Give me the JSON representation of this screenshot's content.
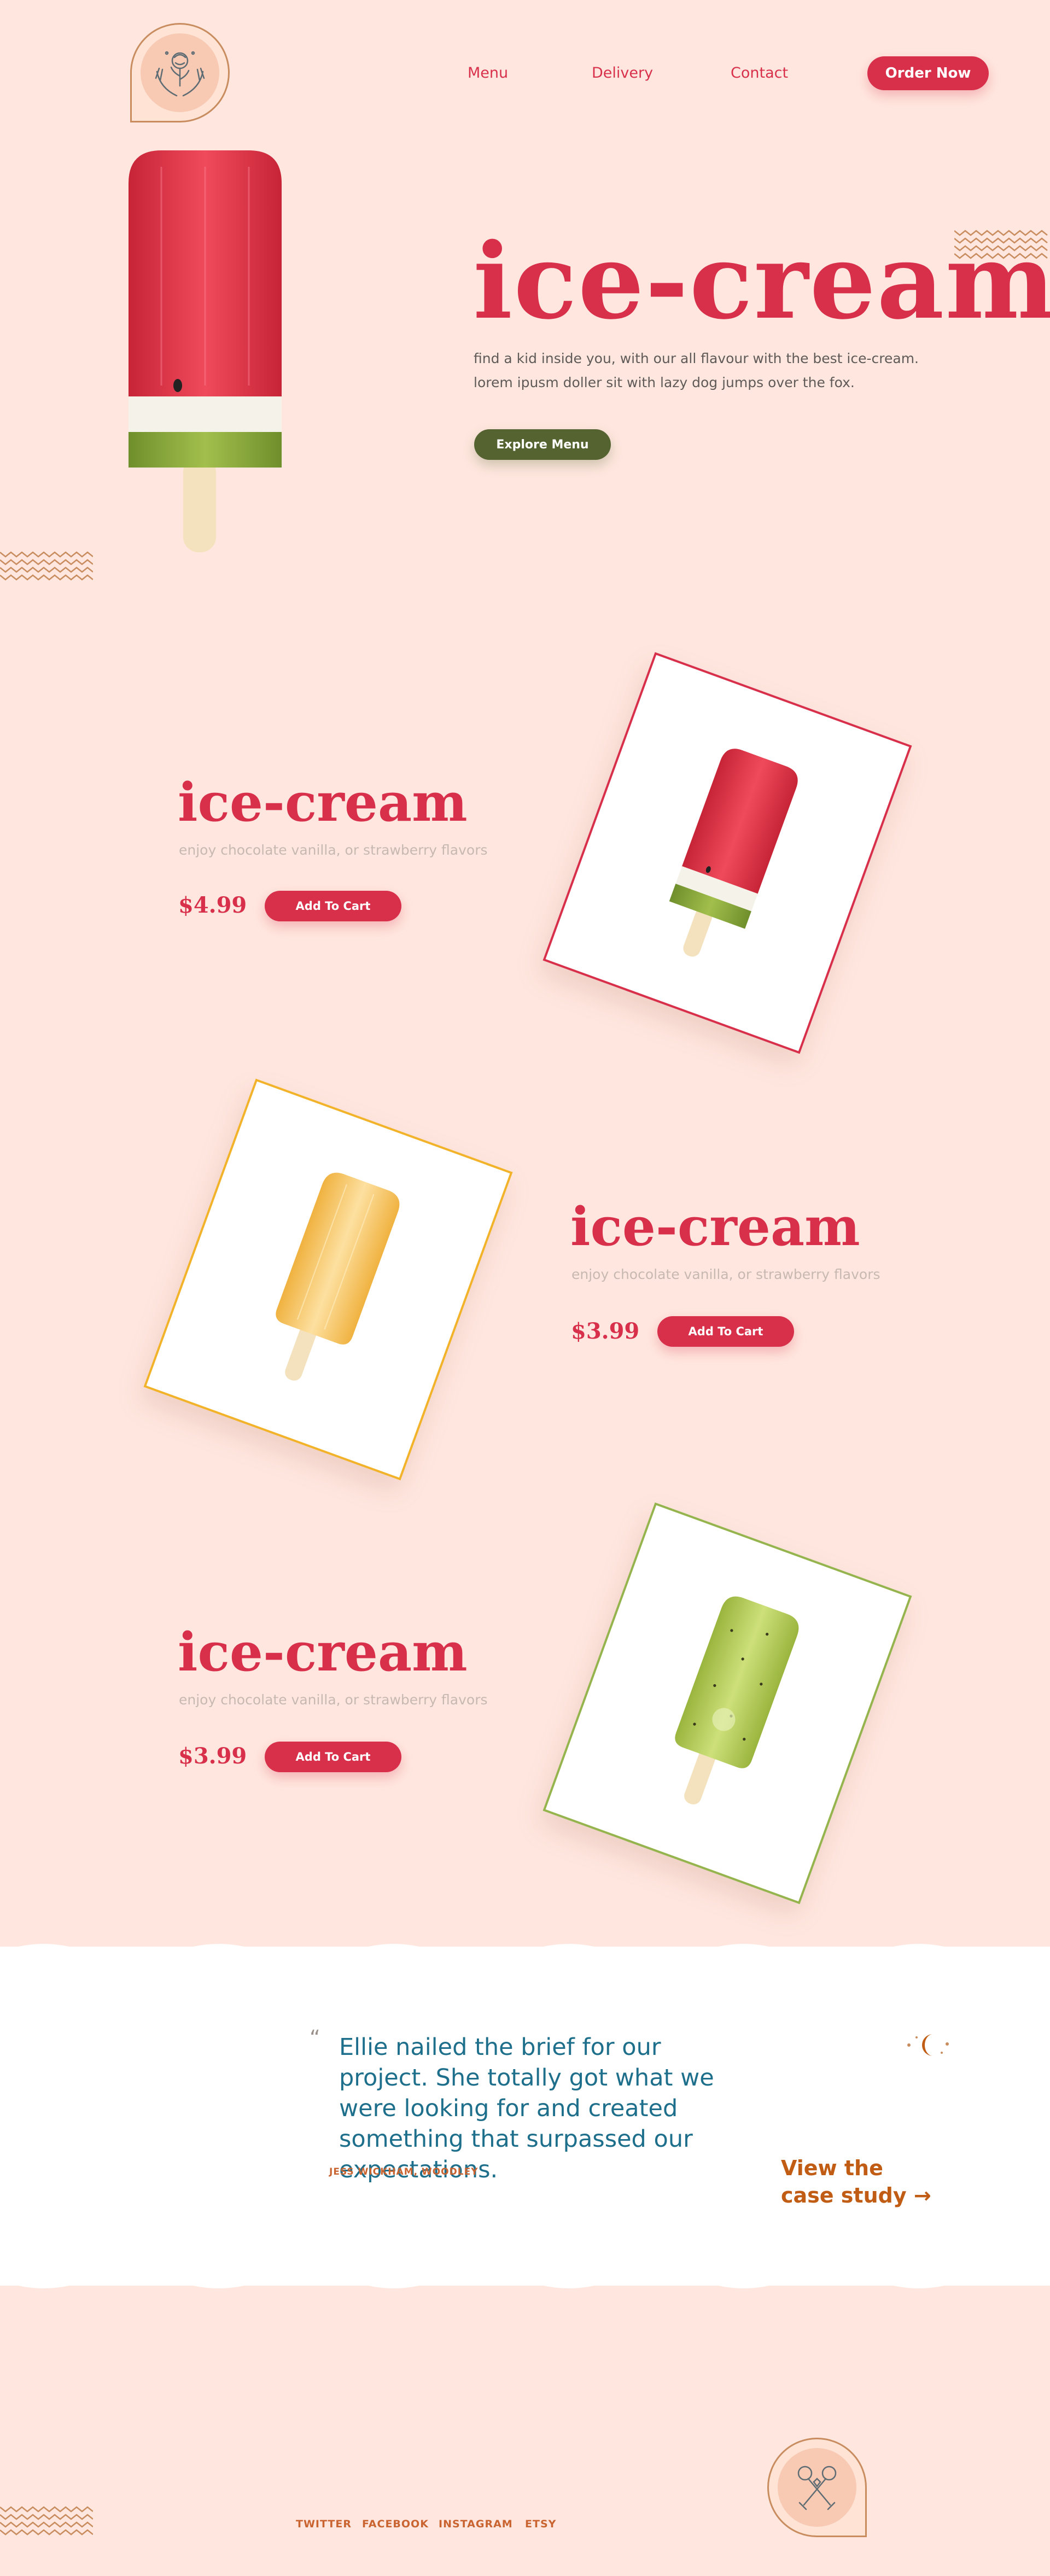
{
  "header": {
    "nav": [
      "Menu",
      "Delivery",
      "Contact"
    ],
    "order_button": "Order Now"
  },
  "hero": {
    "title": "ice-cream",
    "description": "find a kid inside you, with our all flavour with the best ice-cream. lorem ipusm doller sit with lazy dog jumps over the fox.",
    "button": "Explore Menu"
  },
  "products": [
    {
      "title": "ice-cream",
      "subtitle": "enjoy chocolate vanilla, or strawberry flavors",
      "price": "$4.99",
      "button": "Add To Cart",
      "flavor": "watermelon",
      "border_color": "#d8304b"
    },
    {
      "title": "ice-cream",
      "subtitle": "enjoy chocolate vanilla, or strawberry flavors",
      "price": "$3.99",
      "button": "Add To Cart",
      "flavor": "mango",
      "border_color": "#f2b32b"
    },
    {
      "title": "ice-cream",
      "subtitle": "enjoy chocolate vanilla, or strawberry flavors",
      "price": "$3.99",
      "button": "Add To Cart",
      "flavor": "kiwi",
      "border_color": "#95b44d"
    }
  ],
  "testimonial": {
    "quote": "Ellie nailed the brief for our project. She totally got what we were looking for and created something that surpassed our expectations.",
    "author": "JESS WICKHAM, WOODLEY",
    "case_study_line1": "View the",
    "case_study_line2": "case study →"
  },
  "footer": {
    "links": [
      "TWITTER",
      "FACEBOOK",
      "INSTAGRAM",
      "ETSY"
    ]
  },
  "colors": {
    "background": "#ffe7df",
    "accent_red": "#d8304b",
    "accent_green": "#54632f",
    "testimonial_blue": "#1e6f8b",
    "footer_orange": "#c96330"
  }
}
